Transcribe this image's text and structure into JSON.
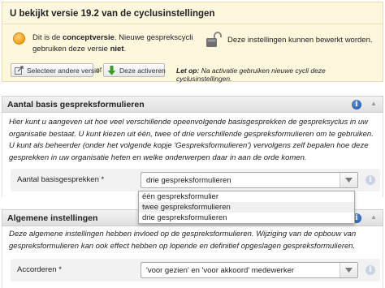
{
  "version": {
    "title": "U bekijkt versie 19.2 van de cyclusinstellingen",
    "concept_pre": "Dit is de ",
    "concept_bold": "conceptversie",
    "concept_mid": ". Nieuwe gesprekscycli gebruiken deze versie ",
    "concept_not": "niet",
    "concept_end": ".",
    "lock_text": "Deze instellingen kunnen bewerkt worden.",
    "select_button": "Selecteer andere versie",
    "of_text": "of",
    "activate_button": "Deze activeren",
    "letop_label": "Let op:",
    "letop_text": " Na activatie gebruiken nieuwe cycli deze cyclusinstellingen."
  },
  "section1": {
    "title": "Aantal basis gespreksformulieren",
    "description": "Hier kunt u aangeven uit hoe veel verschillende opeenvolgende basisgesprekken de gespreksyclus in uw organisatie bestaat. U kunt kiezen uit één, twee of drie verschillende gespreksformulieren om te gebruiken. U kunt als beheerder (onder het volgende kopje 'Gespreksformulieren') vervolgens zelf bepalen hoe deze gesprekken in uw organisatie heten en welke onderwerpen daar in aan de orde komen.",
    "field_label": "Aantal basisgesprekken *",
    "selected_value": "drie gespreksformulieren",
    "options": [
      "één gespreksformulier",
      "twee gespreksformulieren",
      "drie gespreksformulieren"
    ]
  },
  "section2": {
    "title": "Algemene instellingen",
    "description": "Deze algemene instellingen hebben invloed op de gespreksformulieren. Wijziging van de opbouw van gespreksformulieren kan ook effect hebben op lopende en definitief opgeslagen gespreksformulieren.",
    "field_label": "Accorderen *",
    "selected_value": "'voor gezien' en 'voor akkoord' medewerker"
  },
  "colors": {
    "version_bg": "#fdf7de",
    "info_blue": "#1f4fa8",
    "concept_orange": "#f5a623",
    "activate_green": "#3a9a2a"
  },
  "icons": {
    "status": "orange-dot-icon",
    "lock": "unlocked-padlock-icon",
    "select": "edit-arrow-icon",
    "activate": "down-arrow-icon",
    "info": "info-icon",
    "collapse": "chevron-up-icon",
    "dropdown": "triangle-down-icon"
  }
}
